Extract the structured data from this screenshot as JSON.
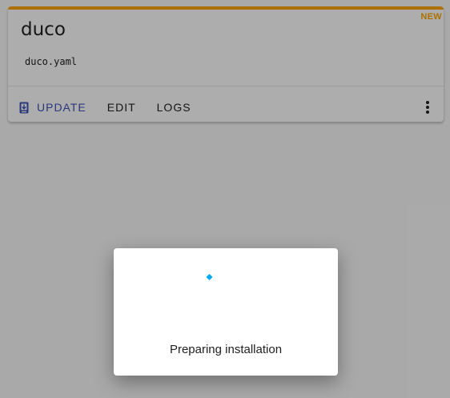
{
  "card": {
    "badge": "NEW",
    "title": "duco",
    "filename": "duco.yaml",
    "actions": {
      "update_label": "UPDATE",
      "edit_label": "EDIT",
      "logs_label": "LOGS"
    },
    "icons": {
      "update": "download-icon",
      "more": "more-vertical-icon"
    },
    "colors": {
      "accent_border": "#ffa600",
      "primary": "#3f51b5"
    }
  },
  "dialog": {
    "status_text": "Preparing installation",
    "spinner_color": "#03a9f4",
    "icon": "loading-spinner-icon"
  }
}
